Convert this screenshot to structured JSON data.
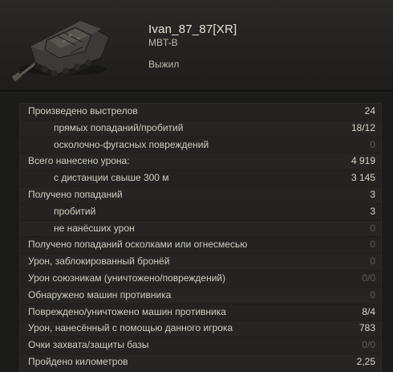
{
  "header": {
    "player_name": "Ivan_87_87[XR]",
    "tank_name": "MBT-B",
    "status": "Выжил"
  },
  "stats": [
    {
      "label": "Произведено выстрелов",
      "value": "24",
      "indent": false,
      "zero": false
    },
    {
      "label": "прямых попаданий/пробитий",
      "value": "18/12",
      "indent": true,
      "zero": false
    },
    {
      "label": "осколочно-фугасных повреждений",
      "value": "0",
      "indent": true,
      "zero": true
    },
    {
      "label": "Всего нанесено урона:",
      "value": "4 919",
      "indent": false,
      "zero": false
    },
    {
      "label": "с дистанции свыше 300 м",
      "value": "3 145",
      "indent": true,
      "zero": false
    },
    {
      "label": "Получено попаданий",
      "value": "3",
      "indent": false,
      "zero": false
    },
    {
      "label": "пробитий",
      "value": "3",
      "indent": true,
      "zero": false
    },
    {
      "label": "не нанёсших урон",
      "value": "0",
      "indent": true,
      "zero": true
    },
    {
      "label": "Получено попаданий осколками или огнесмесью",
      "value": "0",
      "indent": false,
      "zero": true
    },
    {
      "label": "Урон, заблокированный бронёй",
      "value": "0",
      "indent": false,
      "zero": true
    },
    {
      "label": "Урон союзникам (уничтожено/повреждений)",
      "value": "0/0",
      "indent": false,
      "zero": true
    },
    {
      "label": "Обнаружено машин противника",
      "value": "0",
      "indent": false,
      "zero": true
    },
    {
      "label": "Повреждено/уничтожено машин противника",
      "value": "8/4",
      "indent": false,
      "zero": false
    },
    {
      "label": "Урон, нанесённый с помощью данного игрока",
      "value": "783",
      "indent": false,
      "zero": false
    },
    {
      "label": "Очки захвата/защиты базы",
      "value": "0/0",
      "indent": false,
      "zero": true
    },
    {
      "label": "Пройдено километров",
      "value": "2,25",
      "indent": false,
      "zero": false
    }
  ]
}
